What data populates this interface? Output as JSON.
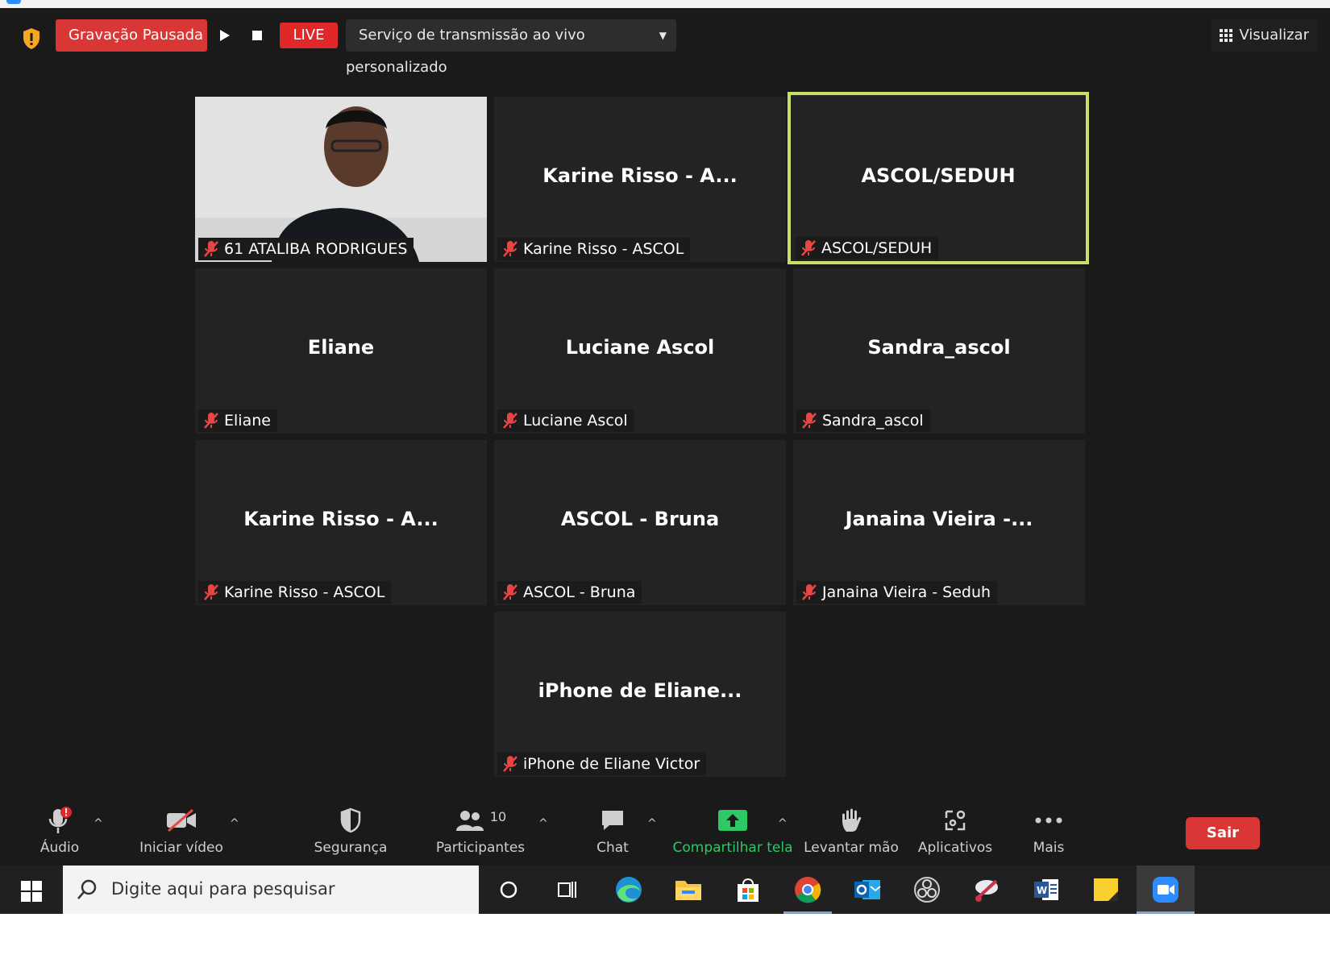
{
  "topbar": {
    "recording_label": "Gravação Pausada",
    "live_label": "LIVE",
    "stream_service": "Serviço de transmissão ao vivo personalizado",
    "view_label": "Visualizar"
  },
  "tiles": [
    {
      "display": "",
      "tag": "61 ATALIBA RODRIGUES"
    },
    {
      "display": "Karine Risso - A...",
      "tag": "Karine Risso - ASCOL"
    },
    {
      "display": "ASCOL/SEDUH",
      "tag": "ASCOL/SEDUH"
    },
    {
      "display": "Eliane",
      "tag": "Eliane"
    },
    {
      "display": "Luciane Ascol",
      "tag": "Luciane Ascol"
    },
    {
      "display": "Sandra_ascol",
      "tag": "Sandra_ascol"
    },
    {
      "display": "Karine Risso - A...",
      "tag": "Karine Risso - ASCOL"
    },
    {
      "display": "ASCOL - Bruna",
      "tag": "ASCOL - Bruna"
    },
    {
      "display": "Janaina Vieira -...",
      "tag": "Janaina Vieira - Seduh"
    },
    {
      "display": "iPhone de Eliane...",
      "tag": "iPhone de Eliane Victor"
    }
  ],
  "toolbar": {
    "audio": "Áudio",
    "video": "Iniciar vídeo",
    "security": "Segurança",
    "participants": "Participantes",
    "participants_count": "10",
    "chat": "Chat",
    "share": "Compartilhar tela",
    "raise_hand": "Levantar mão",
    "apps": "Aplicativos",
    "more": "Mais",
    "leave": "Sair"
  },
  "taskbar": {
    "search_placeholder": "Digite aqui para pesquisar",
    "icons": [
      "windows-start-icon",
      "task-view-icon",
      "timeline-icon",
      "edge-icon",
      "file-explorer-icon",
      "store-icon",
      "chrome-icon",
      "outlook-icon",
      "obs-icon",
      "snipping-icon",
      "word-icon",
      "sticky-notes-icon",
      "zoom-icon"
    ]
  },
  "colors": {
    "accent_red": "#d93636",
    "live_red": "#e02828",
    "active_speaker": "#c6e06a",
    "share_green": "#2ec866"
  }
}
